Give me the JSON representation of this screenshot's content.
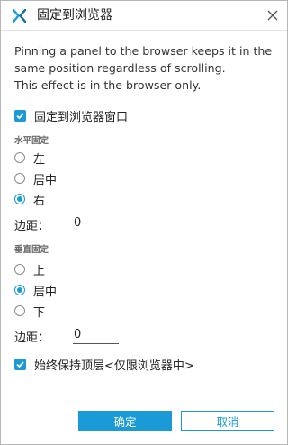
{
  "dialog": {
    "title": "固定到浏览器",
    "logo_icon": "x-logo-icon",
    "close_icon": "close-icon"
  },
  "description": {
    "line1": "Pinning a panel to the browser keeps it in the",
    "line2": "same position regardless of scrolling.",
    "line3": "This effect is in the browser only."
  },
  "pin_to_window": {
    "label": "固定到浏览器窗口",
    "checked": true
  },
  "horizontal": {
    "section_label": "水平固定",
    "options": [
      {
        "label": "左",
        "checked": false
      },
      {
        "label": "居中",
        "checked": false
      },
      {
        "label": "右",
        "checked": true
      }
    ],
    "margin_label": "边距：",
    "margin_value": "0"
  },
  "vertical": {
    "section_label": "垂直固定",
    "options": [
      {
        "label": "上",
        "checked": false
      },
      {
        "label": "居中",
        "checked": true
      },
      {
        "label": "下",
        "checked": false
      }
    ],
    "margin_label": "边距：",
    "margin_value": "0"
  },
  "keep_on_top": {
    "label": "始终保持顶层<仅限浏览器中>",
    "checked": true
  },
  "buttons": {
    "ok_label": "确定",
    "cancel_label": "取消"
  },
  "colors": {
    "accent": "#1a9ad6",
    "border": "#b6b6b6",
    "divider": "#e3e3e3"
  }
}
